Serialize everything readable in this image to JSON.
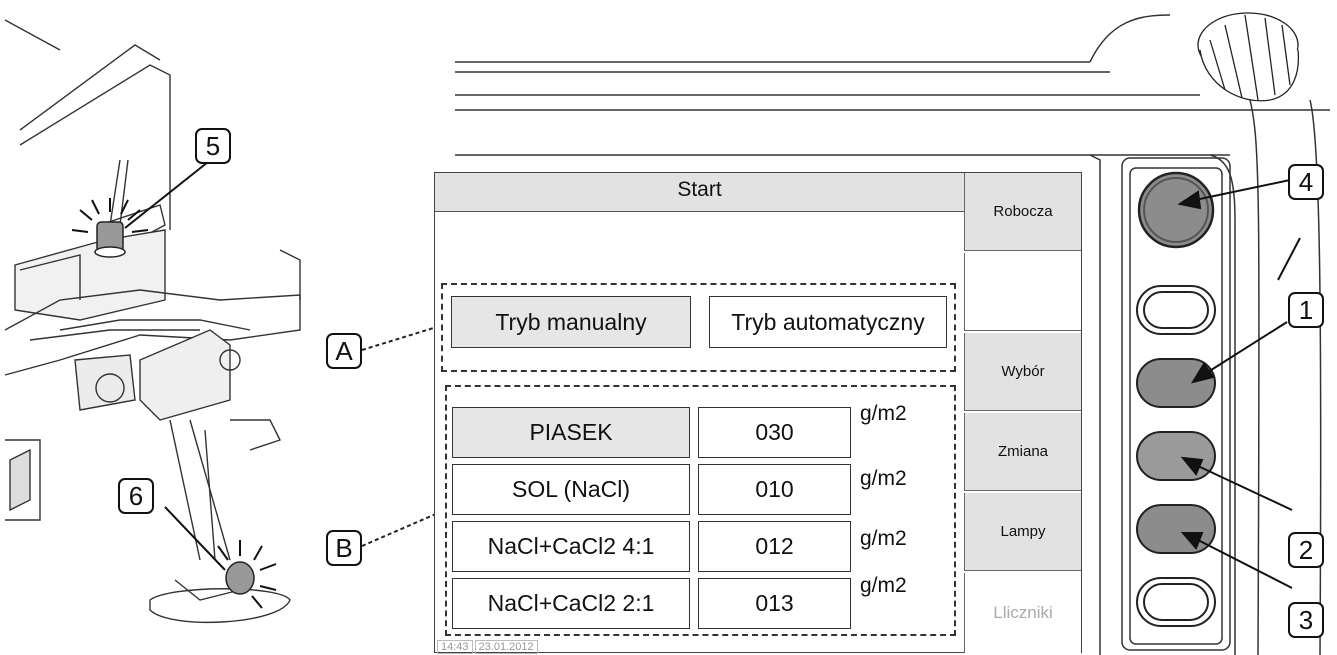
{
  "screen": {
    "title": "Start",
    "side_buttons": [
      "Robocza",
      "",
      "Wybór",
      "Zmiana",
      "Lampy",
      "Lliczniki"
    ],
    "mode_buttons": [
      "Tryb manualny",
      "Tryb automatyczny"
    ],
    "materials": [
      {
        "name": "PIASEK",
        "value": "030",
        "unit": "g/m2"
      },
      {
        "name": "SOL (NaCl)",
        "value": "010",
        "unit": "g/m2"
      },
      {
        "name": "NaCl+CaCl2 4:1",
        "value": "012",
        "unit": "g/m2"
      },
      {
        "name": "NaCl+CaCl2 2:1",
        "value": "013",
        "unit": "g/m2"
      }
    ],
    "status_time": "14:43",
    "status_date": "23.01.2012"
  },
  "callouts": {
    "A": "A",
    "B": "B",
    "n1": "1",
    "n2": "2",
    "n3": "3",
    "n4": "4",
    "n5": "5",
    "n6": "6"
  },
  "colors": {
    "button_grey": "#e2e2e2",
    "knob_dark": "#8c8c8c",
    "knob_light": "#ffffff"
  }
}
